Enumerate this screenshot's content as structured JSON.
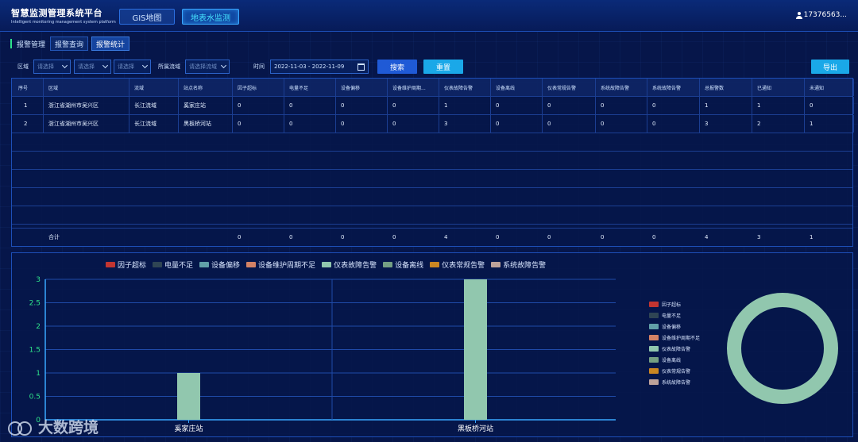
{
  "header": {
    "title": "智慧监测管理系统平台",
    "subtitle": "Intelligent monitoring management system platform",
    "tabs": [
      {
        "label": "GIS地图"
      },
      {
        "label": "地表水监测"
      }
    ],
    "user": "17376563..."
  },
  "subnav": {
    "title": "报警管理",
    "tabs": [
      {
        "label": "报警查询"
      },
      {
        "label": "报警统计"
      }
    ]
  },
  "filters": {
    "region_label": "区域",
    "select1": "请选择",
    "select2": "请选择",
    "select3": "请选择",
    "basin_label": "所属流域",
    "basin_placeholder": "请选择流域",
    "time_label": "时间",
    "date_range": "2022-11-03 - 2022-11-09",
    "search_label": "搜索",
    "reset_label": "重置",
    "export_label": "导出"
  },
  "table": {
    "headers": [
      "序号",
      "区域",
      "流域",
      "站点名称",
      "因子超标",
      "电量不足",
      "设备偏移",
      "设备维护周期...",
      "仪表故障告警",
      "设备离线",
      "仪表常规告警",
      "系统故障告警",
      "系统故障告警",
      "总报警数",
      "已通知",
      "未通知"
    ],
    "rows": [
      [
        "1",
        "浙江省湖州市吴兴区",
        "长江流域",
        "奚家庄站",
        "0",
        "0",
        "0",
        "0",
        "1",
        "0",
        "0",
        "0",
        "0",
        "1",
        "1",
        "0"
      ],
      [
        "2",
        "浙江省湖州市吴兴区",
        "长江流域",
        "黑板桥河站",
        "0",
        "0",
        "0",
        "0",
        "3",
        "0",
        "0",
        "0",
        "0",
        "3",
        "2",
        "1"
      ]
    ],
    "total": [
      "",
      "合计",
      "",
      "",
      "0",
      "0",
      "0",
      "0",
      "4",
      "0",
      "0",
      "0",
      "0",
      "4",
      "3",
      "1"
    ]
  },
  "colors": {
    "因子超标": "#c23531",
    "电量不足": "#2f4554",
    "设备偏移": "#61a0a8",
    "设备维护周期不足": "#d48265",
    "仪表故障告警": "#91c7ae",
    "设备离线": "#749f83",
    "仪表常规告警": "#ca8622",
    "系统故障告警": "#bda29a"
  },
  "chart_data": [
    {
      "type": "bar",
      "categories": [
        "奚家庄站",
        "黑板桥河站"
      ],
      "series": [
        {
          "name": "因子超标",
          "values": [
            0,
            0
          ]
        },
        {
          "name": "电量不足",
          "values": [
            0,
            0
          ]
        },
        {
          "name": "设备偏移",
          "values": [
            0,
            0
          ]
        },
        {
          "name": "设备维护周期不足",
          "values": [
            0,
            0
          ]
        },
        {
          "name": "仪表故障告警",
          "values": [
            1,
            3
          ]
        },
        {
          "name": "设备离线",
          "values": [
            0,
            0
          ]
        },
        {
          "name": "仪表常规告警",
          "values": [
            0,
            0
          ]
        },
        {
          "name": "系统故障告警",
          "values": [
            0,
            0
          ]
        }
      ],
      "yticks": [
        "0",
        "0.5",
        "1",
        "1.5",
        "2",
        "2.5",
        "3"
      ],
      "ylim": [
        0,
        3
      ],
      "legend": "top",
      "grid": true
    },
    {
      "type": "pie",
      "labels": [
        "因子超标",
        "电量不足",
        "设备偏移",
        "设备维护周期不足",
        "仪表故障告警",
        "设备离线",
        "仪表常规告警",
        "系统故障告警"
      ],
      "values": [
        0,
        0,
        0,
        0,
        4,
        0,
        0,
        0
      ],
      "donut": true,
      "legend": "left"
    }
  ],
  "watermark": "大数跨境"
}
